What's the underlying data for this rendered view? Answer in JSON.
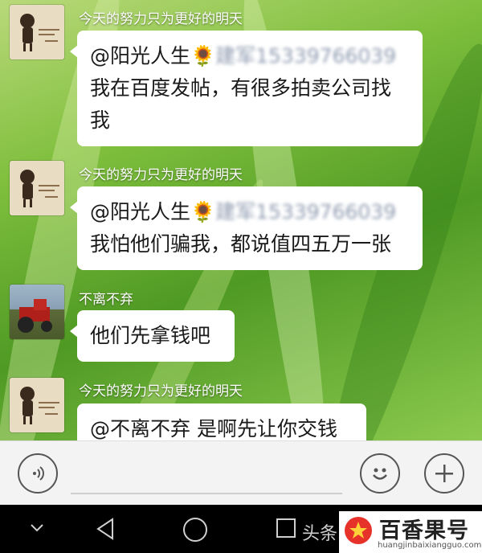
{
  "messages": [
    {
      "sender": "今天的努力只为更好的明天",
      "mention": "@阳光人生",
      "sun": "🌻",
      "blurred": "建军15339766039",
      "lines": [
        "我在百度发帖，有很多拍卖公司找",
        "我"
      ]
    },
    {
      "sender": "今天的努力只为更好的明天",
      "mention": "@阳光人生",
      "sun": "🌻",
      "blurred": "建军15339766039",
      "lines": [
        "我怕他们骗我，都说值四五万一张"
      ]
    },
    {
      "sender": "不离不弃",
      "text": "他们先拿钱吧"
    },
    {
      "sender": "今天的努力只为更好的明天",
      "text": "@不离不弃 是啊先让你交钱"
    }
  ],
  "nav_partial_label": "头条",
  "watermark": {
    "brand": "百香果号",
    "url": "huangjinbaixiangguo.com"
  },
  "icons": [
    "voice-icon",
    "emoji-icon",
    "add-icon",
    "back-icon",
    "home-icon",
    "recents-icon",
    "chevron-down-icon"
  ]
}
